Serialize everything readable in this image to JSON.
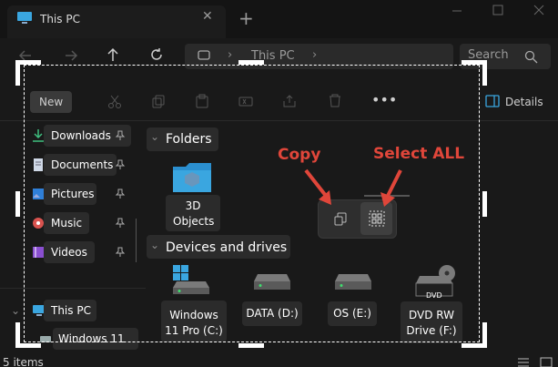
{
  "window": {
    "tab_title": "This PC",
    "close_glyph": "✕",
    "new_tab_glyph": "+"
  },
  "address": {
    "path_label": "This PC",
    "search_placeholder": "Search"
  },
  "toolbar": {
    "new_label": "New",
    "details_label": "Details"
  },
  "sidebar": {
    "quick_access": [
      {
        "label": "Downloads",
        "icon": "download-icon"
      },
      {
        "label": "Documents",
        "icon": "documents-icon"
      },
      {
        "label": "Pictures",
        "icon": "pictures-icon"
      },
      {
        "label": "Music",
        "icon": "music-icon"
      },
      {
        "label": "Videos",
        "icon": "videos-icon"
      }
    ],
    "this_pc_label": "This PC",
    "windows_label": "Windows 11"
  },
  "main": {
    "folders_header": "Folders",
    "folders": [
      {
        "label": "3D Objects"
      }
    ],
    "drives_header": "Devices and drives",
    "drives": [
      {
        "label": "Windows 11 Pro (C:)"
      },
      {
        "label": "DATA (D:)"
      },
      {
        "label": "OS (E:)"
      },
      {
        "label": "DVD RW Drive (F:)",
        "badge": "DVD"
      }
    ]
  },
  "annotations": {
    "copy": "Copy",
    "select_all": "Select ALL"
  },
  "status": {
    "items_count": "5 items"
  },
  "colors": {
    "annotation_red": "#e0463a",
    "accent": "#4cc2ff"
  }
}
